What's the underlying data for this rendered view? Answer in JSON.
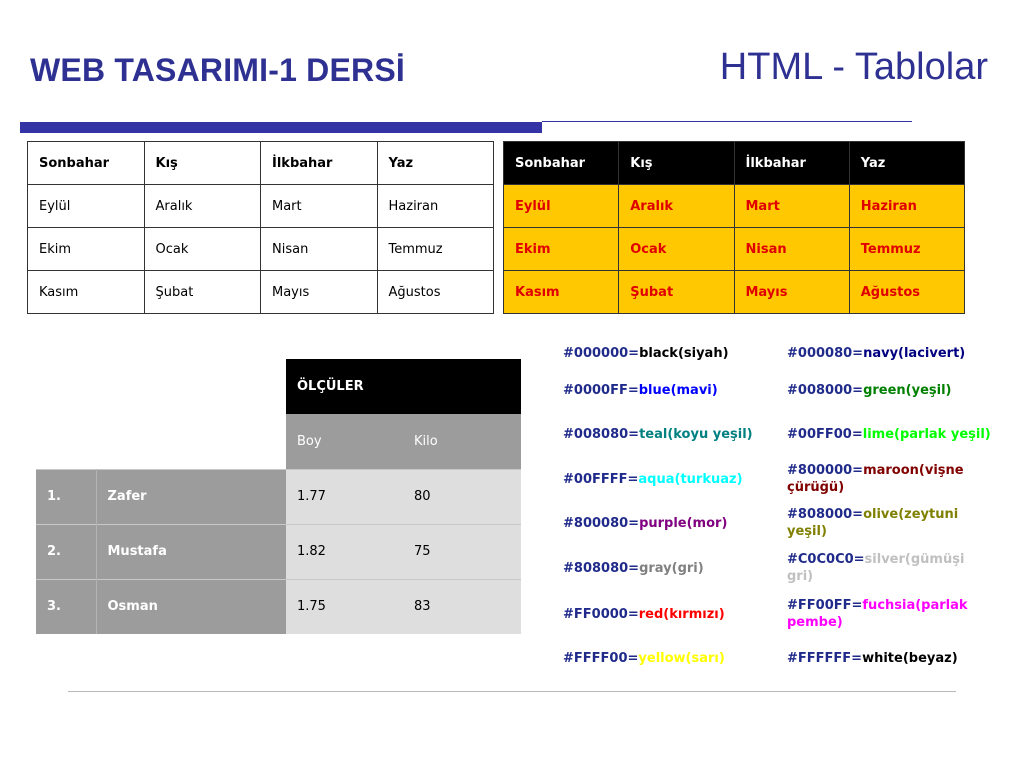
{
  "header": {
    "course_title": "WEB TASARIMI-1 DERSİ",
    "topic_title": "HTML - Tablolar"
  },
  "table1": {
    "headers": [
      "Sonbahar",
      "Kış",
      "İlkbahar",
      "Yaz"
    ],
    "rows": [
      [
        "Eylül",
        "Aralık",
        "Mart",
        "Haziran"
      ],
      [
        "Ekim",
        "Ocak",
        "Nisan",
        "Temmuz"
      ],
      [
        "Kasım",
        "Şubat",
        "Mayıs",
        "Ağustos"
      ]
    ]
  },
  "table2": {
    "headers": [
      "Sonbahar",
      "Kış",
      "İlkbahar",
      "Yaz"
    ],
    "rows": [
      [
        "Eylül",
        "Aralık",
        "Mart",
        "Haziran"
      ],
      [
        "Ekim",
        "Ocak",
        "Nisan",
        "Temmuz"
      ],
      [
        "Kasım",
        "Şubat",
        "Mayıs",
        "Ağustos"
      ]
    ],
    "colors": {
      "header_bg": "#000000",
      "body_bg": "#ffc800",
      "body_text": "#e00000"
    }
  },
  "table3": {
    "group_header": "ÖLÇÜLER",
    "sub_headers": [
      "Boy",
      "Kilo"
    ],
    "rows": [
      {
        "no": "1.",
        "name": "Zafer",
        "boy": "1.77",
        "kilo": "80"
      },
      {
        "no": "2.",
        "name": "Mustafa",
        "boy": "1.82",
        "kilo": "75"
      },
      {
        "no": "3.",
        "name": "Osman",
        "boy": "1.75",
        "kilo": "83"
      }
    ]
  },
  "color_list": [
    [
      {
        "code": "#000000=",
        "name": "black(siyah)",
        "color": "#000000"
      },
      {
        "code": "#000080=",
        "name": "navy(lacivert)",
        "color": "#000080"
      }
    ],
    [
      {
        "code": "#0000FF=",
        "name": "blue(mavi)",
        "color": "#0000ff"
      },
      {
        "code": "#008000=",
        "name": "green(yeşil)",
        "color": "#008000"
      }
    ],
    [
      {
        "code": "#008080=",
        "name": "teal(koyu yeşil)",
        "color": "#008080"
      },
      {
        "code": "#00FF00=",
        "name": "lime(parlak yeşil)",
        "color": "#00ff00"
      }
    ],
    [
      {
        "code": "#00FFFF=",
        "name": "aqua(turkuaz)",
        "color": "#00ffff"
      },
      {
        "code": "#800000=",
        "name": "maroon(vişne çürüğü)",
        "color": "#800000"
      }
    ],
    [
      {
        "code": "#800080=",
        "name": "purple(mor)",
        "color": "#800080"
      },
      {
        "code": "#808000=",
        "name": "olive(zeytuni yeşil)",
        "color": "#808000"
      }
    ],
    [
      {
        "code": "#808080=",
        "name": "gray(gri)",
        "color": "#808080"
      },
      {
        "code": "#C0C0C0=",
        "name": "silver(gümüşi gri)",
        "color": "#c0c0c0"
      }
    ],
    [
      {
        "code": "#FF0000=",
        "name": "red(kırmızı)",
        "color": "#ff0000"
      },
      {
        "code": "#FF00FF=",
        "name": "fuchsia(parlak pembe)",
        "color": "#ff00ff"
      }
    ],
    [
      {
        "code": "#FFFF00=",
        "name": "yellow(sarı)",
        "color": "#ffff00"
      },
      {
        "code": "#FFFFFF=",
        "name": "white(beyaz)",
        "color": "#000000"
      }
    ]
  ]
}
